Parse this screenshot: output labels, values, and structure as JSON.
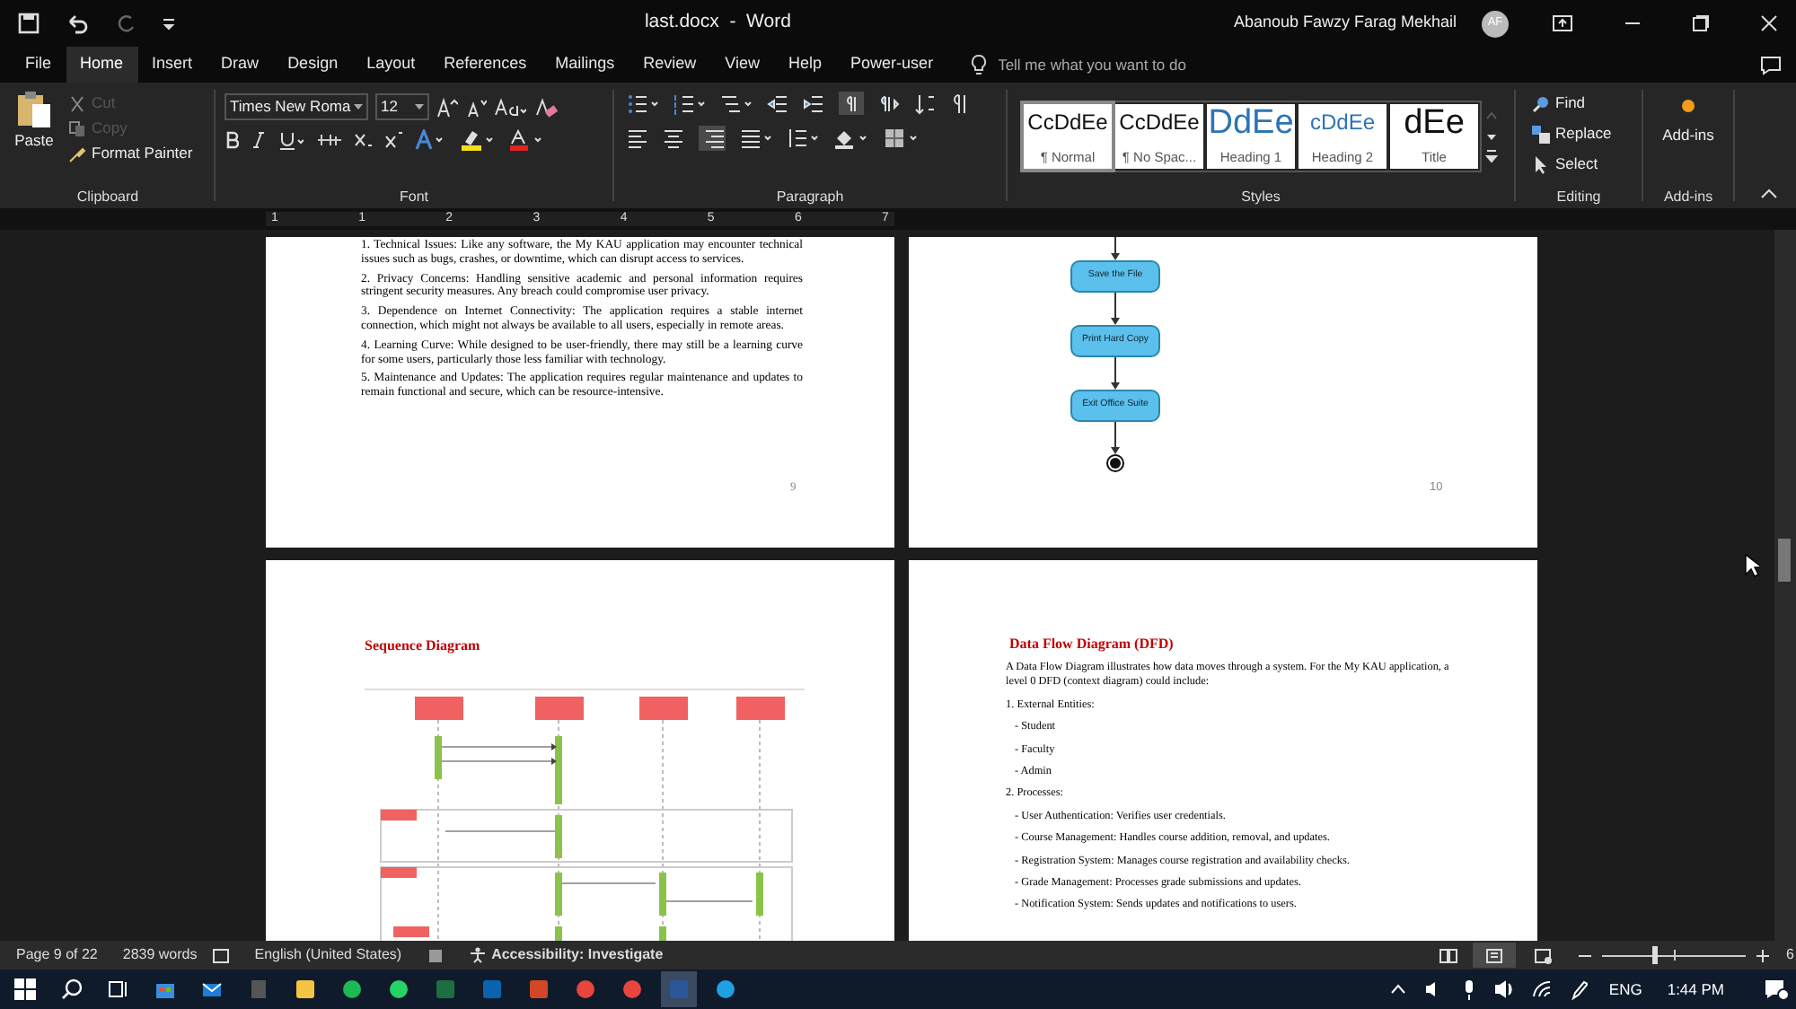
{
  "title_bar": {
    "document_title": "last.docx  -  Word",
    "user_name": "Abanoub Fawzy Farag Mekhail",
    "user_initials": "AF"
  },
  "menu_tabs": [
    {
      "label": "File",
      "selected": false
    },
    {
      "label": "Home",
      "selected": true
    },
    {
      "label": "Insert",
      "selected": false
    },
    {
      "label": "Draw",
      "selected": false
    },
    {
      "label": "Design",
      "selected": false
    },
    {
      "label": "Layout",
      "selected": false
    },
    {
      "label": "References",
      "selected": false
    },
    {
      "label": "Mailings",
      "selected": false
    },
    {
      "label": "Review",
      "selected": false
    },
    {
      "label": "View",
      "selected": false
    },
    {
      "label": "Help",
      "selected": false
    },
    {
      "label": "Power-user",
      "selected": false
    }
  ],
  "tell_me": {
    "placeholder": "Tell me what you want to do"
  },
  "ribbon": {
    "clipboard": {
      "label": "Clipboard",
      "paste": "Paste",
      "commands": [
        {
          "label": "Cut",
          "disabled": true
        },
        {
          "label": "Copy",
          "disabled": true
        },
        {
          "label": "Format Painter",
          "disabled": false
        }
      ]
    },
    "font": {
      "label": "Font",
      "font_name": "Times New Roma",
      "font_size": "12"
    },
    "paragraph": {
      "label": "Paragraph"
    },
    "styles": {
      "label": "Styles",
      "items": [
        {
          "preview": "CcDdEe",
          "name": "¶ Normal",
          "selected": true
        },
        {
          "preview": "CcDdEe",
          "name": "¶ No Spac...",
          "selected": false
        },
        {
          "preview": "DdEe",
          "name": "Heading 1",
          "selected": false
        },
        {
          "preview": "cDdEe",
          "name": "Heading 2",
          "selected": false
        },
        {
          "preview": "dEe",
          "name": "Title",
          "selected": false
        }
      ]
    },
    "editing": {
      "label": "Editing",
      "commands": [
        "Find",
        "Replace",
        "Select"
      ]
    },
    "addins": {
      "label": "Add-ins",
      "button": "Add-ins"
    }
  },
  "ruler": [
    "1",
    "1",
    "2",
    "3",
    "4",
    "5",
    "6",
    "7"
  ],
  "pages": [
    {
      "kind": "text",
      "paragraphs": [
        "1. Technical Issues: Like any software, the My KAU application may encounter technical issues such as bugs, crashes, or downtime, which can disrupt access to services.",
        "2. Privacy Concerns: Handling sensitive academic and personal information requires stringent security measures. Any breach could compromise user privacy.",
        "3. Dependence on Internet Connectivity: The application requires a stable internet connection, which might not always be available to all users, especially in remote areas.",
        "4. Learning Curve: While designed to be user-friendly, there may still be a learning curve for some users, particularly those less familiar with technology.",
        "5. Maintenance and Updates: The application requires regular maintenance and updates to remain functional and secure, which can be resource-intensive."
      ],
      "page_number": "9"
    },
    {
      "kind": "flowchart",
      "steps": [
        "Save the File",
        "Print Hard Copy",
        "Exit Office Suite"
      ],
      "page_number": "10"
    },
    {
      "kind": "diagram",
      "heading": "Sequence Diagram"
    },
    {
      "kind": "section",
      "heading": "Data Flow Diagram (DFD)",
      "paragraphs": [
        "A Data Flow Diagram illustrates how data moves through a system. For the My KAU application, a level 0 DFD (context diagram) could include:",
        "1. External Entities:",
        "- Student",
        "- Faculty",
        "- Admin",
        "2. Processes:",
        "- User Authentication: Verifies user credentials.",
        "- Course Management: Handles course addition, removal, and updates.",
        "- Registration System: Manages course registration and availability checks.",
        "- Grade Management: Processes grade submissions and updates.",
        "- Notification System: Sends updates and notifications to users."
      ]
    }
  ],
  "status_bar": {
    "page": "Page 9 of 22",
    "words": "2839 words",
    "language": "English (United States)",
    "accessibility": "Accessibility: Investigate",
    "zoom": {
      "level": 0.37,
      "reading": "6"
    }
  },
  "taskbar": {
    "language": "ENG",
    "time": "1:44 PM"
  }
}
